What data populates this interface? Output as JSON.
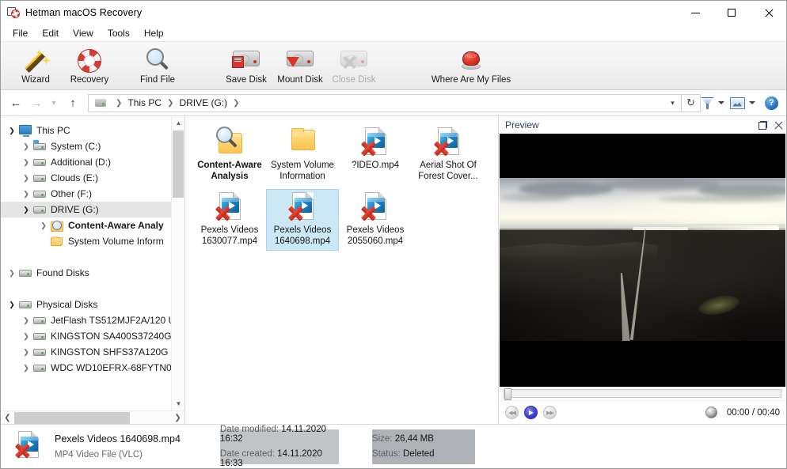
{
  "window": {
    "title": "Hetman macOS Recovery",
    "app_icon": "hetman-lifebuoy-icon",
    "controls": {
      "minimize": "Minimize",
      "maximize": "Maximize",
      "close": "Close"
    }
  },
  "menubar": {
    "items": [
      {
        "label": "File"
      },
      {
        "label": "Edit"
      },
      {
        "label": "View"
      },
      {
        "label": "Tools"
      },
      {
        "label": "Help"
      }
    ]
  },
  "toolbar": {
    "buttons": [
      {
        "label": "Wizard",
        "icon": "magic-wand-icon",
        "enabled": true
      },
      {
        "label": "Recovery",
        "icon": "lifebuoy-icon",
        "enabled": true
      },
      {
        "label": "Find File",
        "icon": "magnifier-icon",
        "enabled": true
      },
      {
        "label": "Save Disk",
        "icon": "disk-save-icon",
        "enabled": true
      },
      {
        "label": "Mount Disk",
        "icon": "disk-mount-icon",
        "enabled": true
      },
      {
        "label": "Close Disk",
        "icon": "disk-close-icon",
        "enabled": false
      },
      {
        "label": "Where Are My Files",
        "icon": "red-help-button-icon",
        "enabled": true
      }
    ]
  },
  "addressbar": {
    "back": "Back",
    "forward": "Forward",
    "history": "Recent locations",
    "up": "Up",
    "drive_icon": "drive-icon",
    "breadcrumbs": [
      {
        "label": "This PC"
      },
      {
        "label": "DRIVE (G:)"
      }
    ],
    "dropdown": "Previous locations",
    "refresh": "Refresh",
    "filter_icon": "filter-funnel-icon",
    "view_icon": "preview-pane-icon",
    "help_icon": "help-circle-icon",
    "help_glyph": "?"
  },
  "tree": {
    "nodes": [
      {
        "label": "This PC",
        "icon": "computer-icon",
        "level": 0,
        "expanded": true,
        "has_children": true,
        "selected": false,
        "bold": false
      },
      {
        "label": "System (C:)",
        "icon": "system-drive-icon",
        "level": 1,
        "expanded": false,
        "has_children": true,
        "selected": false,
        "bold": false
      },
      {
        "label": "Additional (D:)",
        "icon": "drive-icon",
        "level": 1,
        "expanded": false,
        "has_children": true,
        "selected": false,
        "bold": false
      },
      {
        "label": "Clouds (E:)",
        "icon": "drive-icon",
        "level": 1,
        "expanded": false,
        "has_children": true,
        "selected": false,
        "bold": false
      },
      {
        "label": "Other (F:)",
        "icon": "drive-icon",
        "level": 1,
        "expanded": false,
        "has_children": true,
        "selected": false,
        "bold": false
      },
      {
        "label": "DRIVE (G:)",
        "icon": "drive-icon",
        "level": 1,
        "expanded": true,
        "has_children": true,
        "selected": true,
        "bold": false
      },
      {
        "label": "Content-Aware Analy",
        "icon": "content-aware-analysis-icon",
        "level": 2,
        "expanded": false,
        "has_children": true,
        "selected": false,
        "bold": true
      },
      {
        "label": "System Volume Inform",
        "icon": "folder-icon",
        "level": 2,
        "expanded": false,
        "has_children": false,
        "selected": false,
        "bold": false
      },
      {
        "label": "Found Disks",
        "icon": "drive-icon",
        "level": 0,
        "expanded": false,
        "has_children": true,
        "selected": false,
        "bold": false,
        "spacer_before": true
      },
      {
        "label": "Physical Disks",
        "icon": "drive-icon",
        "level": 0,
        "expanded": true,
        "has_children": true,
        "selected": false,
        "bold": false,
        "spacer_before": true
      },
      {
        "label": "JetFlash TS512MJF2A/120 U",
        "icon": "drive-icon",
        "level": 1,
        "expanded": false,
        "has_children": true,
        "selected": false,
        "bold": false
      },
      {
        "label": "KINGSTON SA400S37240G",
        "icon": "drive-icon",
        "level": 1,
        "expanded": false,
        "has_children": true,
        "selected": false,
        "bold": false
      },
      {
        "label": "KINGSTON SHFS37A120G",
        "icon": "drive-icon",
        "level": 1,
        "expanded": false,
        "has_children": true,
        "selected": false,
        "bold": false
      },
      {
        "label": "WDC WD10EFRX-68FYTN0",
        "icon": "drive-icon",
        "level": 1,
        "expanded": false,
        "has_children": true,
        "selected": false,
        "bold": false
      }
    ],
    "scrollbar": {
      "up": "Scroll up",
      "down": "Scroll down",
      "left": "Scroll left",
      "right": "Scroll right"
    }
  },
  "files": {
    "items": [
      {
        "name": "Content-Aware Analysis",
        "icon": "content-aware-analysis-icon",
        "kind": "folder-search",
        "selected": false,
        "deleted": false,
        "bold": true
      },
      {
        "name": "System Volume Information",
        "icon": "folder-icon",
        "kind": "folder",
        "selected": false,
        "deleted": false,
        "bold": false
      },
      {
        "name": "?IDEO.mp4",
        "icon": "mp4-file-icon",
        "kind": "video",
        "selected": false,
        "deleted": true,
        "bold": false
      },
      {
        "name": "Aerial Shot Of Forest Cover...",
        "icon": "mp4-file-icon",
        "kind": "video",
        "selected": false,
        "deleted": true,
        "bold": false
      },
      {
        "name": "Pexels Videos 1630077.mp4",
        "icon": "mp4-file-icon",
        "kind": "video",
        "selected": false,
        "deleted": true,
        "bold": false
      },
      {
        "name": "Pexels Videos 1640698.mp4",
        "icon": "mp4-file-icon",
        "kind": "video",
        "selected": true,
        "deleted": true,
        "bold": false
      },
      {
        "name": "Pexels Videos 2055060.mp4",
        "icon": "mp4-file-icon",
        "kind": "video",
        "selected": false,
        "deleted": true,
        "bold": false
      }
    ]
  },
  "preview": {
    "title": "Preview",
    "undock_icon": "undock-icon",
    "close_icon": "close-icon",
    "content_description": "Aerial video frame of a road crossing dark volcanic terrain with a bright overcast sky",
    "player": {
      "rewind_icon": "rewind-icon",
      "play_icon": "play-icon",
      "forward_icon": "fast-forward-icon",
      "volume_icon": "volume-icon",
      "time": "00:00 / 00:40",
      "seek_position_percent": 0
    }
  },
  "statusbar": {
    "file_icon": "mp4-file-deleted-icon",
    "file_name": "Pexels Videos 1640698.mp4",
    "file_type": "MP4 Video File (VLC)",
    "fields": [
      {
        "label": "Date modified:",
        "value": "14.11.2020 16:32"
      },
      {
        "label": "Date created:",
        "value": "14.11.2020 16:33"
      },
      {
        "label": "Size:",
        "value": "26,44 MB"
      },
      {
        "label": "Status:",
        "value": "Deleted"
      }
    ]
  },
  "colors": {
    "selection_blue": "#cce8f7",
    "tree_selection_gray": "#e5e5e5",
    "accent_red": "#d9342b",
    "preview_title": "#2d3f5c"
  }
}
